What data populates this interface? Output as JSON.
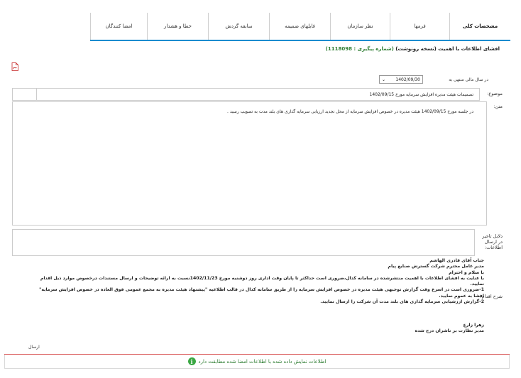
{
  "tabs": [
    "مشخصات کلی",
    "فرمها",
    "نظر سازمان",
    "فایلهای ضمیمه",
    "سابقه گردش",
    "خطا و هشدار",
    "امضا کنندگان"
  ],
  "title": {
    "text": "افشای اطلاعات با اهمیت (نسخه رونوشت)",
    "tracking": "(شماره پیگیری : 1118098)"
  },
  "period": {
    "label": "در سال مالی منتهی به",
    "value": "1402/09/30"
  },
  "subject": {
    "label": "موضوع:",
    "value": "تصمیمات هیئت مدیره افزایش سرمایه مورخ 1402/09/15"
  },
  "body": {
    "label": "متن:",
    "text": "در جلسه مورخ 1402/09/15 هیئت مدیره در خصوص افزایش سرمایه از محل تجدید ارزیابی سرمایه گذاری های بلند مدت به تصویب رسید ."
  },
  "delay": {
    "label": "دلایل تاخیر در ارسال اطلاعات:"
  },
  "action": {
    "label": "شرح اقدام:",
    "lines": [
      "جناب آقای قادری الهاشم",
      "مدیر عامل محترم شرکت گسترش صنایع پیام",
      "با سلام و احترام",
      "با عنایت به افشای اطلاعات با اهمیت منتشرشده در سامانه کدال،ضروری است حداکثر تا پایان وقت اداری روز دوشنبه مورخ 1402/11/23نسبت به ارائه توضیحات و ارسال مستندات درخصوص موارد ذیل اقدام نمایید.",
      "1-ضروری است در اسرع وقت گزارش توجیهی هیئت مدیره در خصوص افزایش سرمایه را از طریق سامانه کدال در قالب اطلاعیه \"پیشنهاد هیئت مدیره به مجمع عمومی فوق العاده در خصوص افزایش سرمایه\" افشا به عموم نمایید.",
      "2-گزارش ارزشیابی سرمایه گذاری های بلند مدت آن شرکت را ارسال نمایید."
    ],
    "signer_name": "زهرا زارع",
    "signer_title": "مدیر نظارت بر ناشران درج شده"
  },
  "send_label": "ارسال",
  "footer": {
    "message": "اطلاعات نمایش داده شده با اطلاعات امضا شده مطابقت دارد"
  },
  "colors": {
    "accent": "#1a8ccf",
    "success": "#2e7d32",
    "divider": "#d64b4b"
  }
}
